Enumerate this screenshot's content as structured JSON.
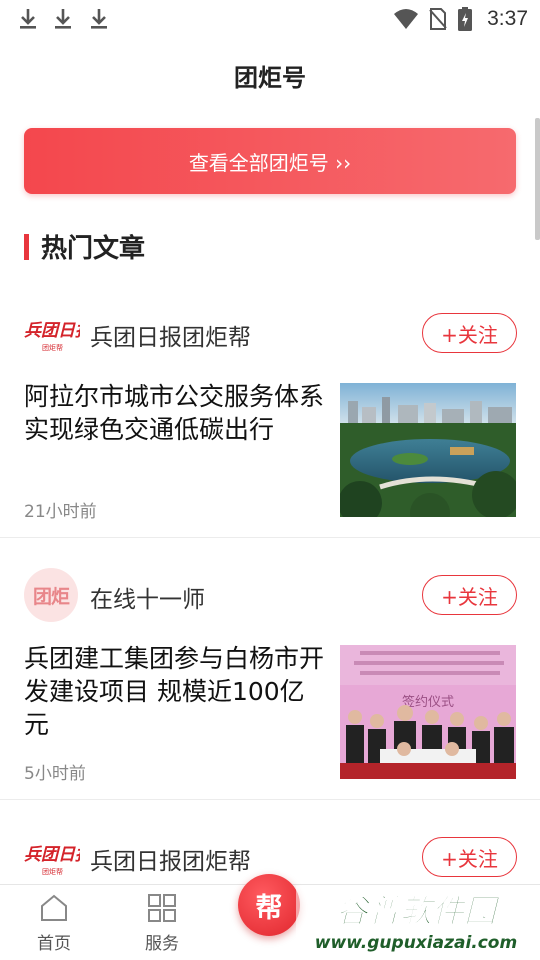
{
  "status_bar": {
    "icons_left": [
      "download-icon",
      "download-icon",
      "download-icon"
    ],
    "icons_right": [
      "wifi-icon",
      "no-sim-icon",
      "battery-charging-icon"
    ],
    "time": "3:37"
  },
  "header": {
    "title": "团炬号"
  },
  "banner": {
    "label": "查看全部团炬号 ››"
  },
  "section": {
    "title": "热门文章"
  },
  "articles": [
    {
      "source_name": "兵团日报团炬帮",
      "logo_text": "兵团日报",
      "follow_label": "+关注",
      "headline": "阿拉尔市城市公交服务体系实现绿色交通低碳出行",
      "time": "21小时前"
    },
    {
      "source_name": "在线十一师",
      "logo_text": "团炬",
      "follow_label": "+关注",
      "headline": "兵团建工集团参与白杨市开发建设项目 规模近100亿元",
      "time": "5小时前"
    },
    {
      "source_name": "兵团日报团炬帮",
      "logo_text": "兵团日报",
      "follow_label": "+关注"
    }
  ],
  "thumb2": {
    "banner_text": "签约仪式"
  },
  "bottom_nav": {
    "items": [
      {
        "label": "首页",
        "icon": "home-icon"
      },
      {
        "label": "服务",
        "icon": "grid-icon"
      }
    ],
    "center_label": "帮"
  },
  "watermark": {
    "title": "谷普软件园",
    "url": "www.gupuxiazai.com"
  },
  "colors": {
    "accent": "#e8363d",
    "banner_start": "#f4474d",
    "banner_end": "#f66a6e"
  }
}
